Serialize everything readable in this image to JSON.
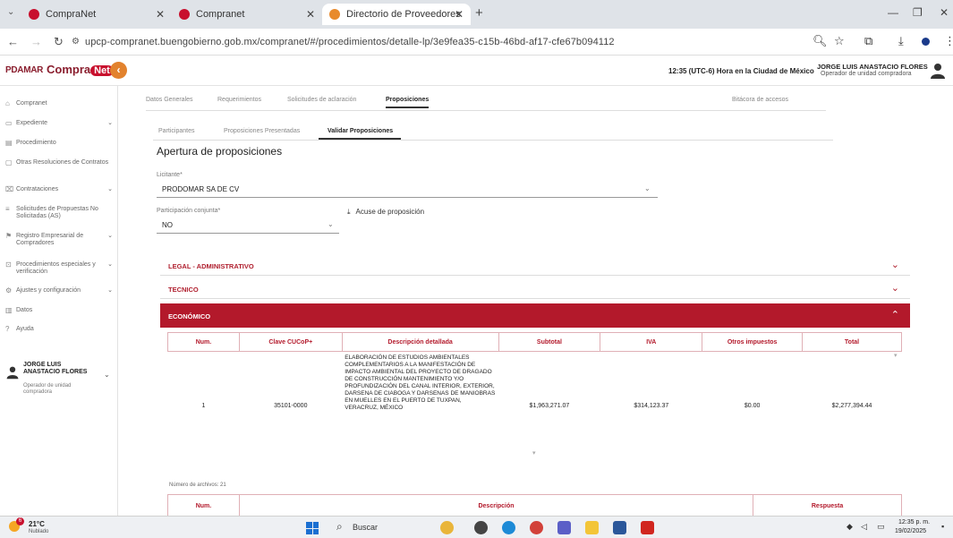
{
  "browser": {
    "tabs": [
      {
        "label": "CompraNet"
      },
      {
        "label": "Compranet"
      },
      {
        "label": "Directorio de Proveedores y C"
      }
    ],
    "url": "upcp-compranet.buengobierno.gob.mx/compranet/#/procedimientos/detalle-lp/3e9fea35-c15b-46bd-af17-cfe67b094112"
  },
  "header": {
    "logo_left": "PDAMAR",
    "logo_compra": "Compra",
    "logo_net": "Net",
    "time_text": "12:35 (UTC-6) Hora en la Ciudad de México",
    "user_name": "JORGE LUIS ANASTACIO FLORES",
    "user_role": "Operador de unidad compradora"
  },
  "sidebar": {
    "items": [
      {
        "label": "Compranet",
        "icon": "home-icon"
      },
      {
        "label": "Expediente",
        "icon": "folder-icon",
        "chevron": "⌄"
      },
      {
        "label": "Procedimiento",
        "icon": "document-icon"
      },
      {
        "label": "Otras Resoluciones de Contratos",
        "icon": "document-icon"
      },
      {
        "label": "Contrataciones",
        "icon": "contract-icon",
        "chevron": "⌄"
      },
      {
        "label": "Solicitudes de Propuestas No Solicitadas (AS)",
        "icon": "list-icon"
      },
      {
        "label": "Registro Empresarial de Compradores",
        "icon": "registry-icon",
        "chevron": "⌄"
      },
      {
        "label": "Procedimientos especiales y verificación",
        "icon": "verify-icon",
        "chevron": "⌄"
      },
      {
        "label": "Ajustes y configuración",
        "icon": "gear-icon",
        "chevron": "⌄"
      },
      {
        "label": "Datos",
        "icon": "data-icon"
      },
      {
        "label": "Ayuda",
        "icon": "help-icon"
      }
    ],
    "user": {
      "name_line1": "JORGE LUIS",
      "name_line2": "ANASTACIO FLORES",
      "role": "Operador de unidad compradora"
    }
  },
  "tabs_primary": [
    {
      "label": "Datos Generales"
    },
    {
      "label": "Requerimientos"
    },
    {
      "label": "Solicitudes de aclaración"
    },
    {
      "label": "Proposiciones"
    },
    {
      "label": "Bitácora de accesos"
    }
  ],
  "tabs_secondary": [
    {
      "label": "Participantes"
    },
    {
      "label": "Proposiciones Presentadas"
    },
    {
      "label": "Validar Proposiciones"
    }
  ],
  "section": {
    "title": "Apertura de proposiciones",
    "licitante_label": "Licitante*",
    "licitante_value": "PRODOMAR SA DE CV",
    "participacion_label": "Participación conjunta*",
    "participacion_value": "NO",
    "acuse_label": "Acuse de proposición"
  },
  "accordions": {
    "legal": "LEGAL - ADMINISTRATIVO",
    "tecnico": "TECNICO",
    "economico": "ECONÓMICO"
  },
  "econ_table": {
    "headers": [
      "Num.",
      "Clave CUCoP+",
      "Descripción detallada",
      "Subtotal",
      "IVA",
      "Otros impuestos",
      "Total"
    ],
    "row": {
      "num": "1",
      "clave": "35101-0000",
      "descripcion": "ELABORACIÓN DE ESTUDIOS AMBIENTALES COMPLEMENTARIOS A LA MANIFESTACIÓN DE IMPACTO AMBIENTAL DEL PROYECTO DE DRAGADO DE CONSTRUCCIÓN MANTENIMIENTO Y/O PROFUNDIZACIÓN DEL CANAL INTERIOR, EXTERIOR, DARSENA DE CIABOGA Y DARSENAS DE MANIOBRAS EN MUELLES EN EL PUERTO DE TUXPAN, VERACRUZ, MÉXICO",
      "subtotal": "$1,963,271.07",
      "iva": "$314,123.37",
      "otros": "$0.00",
      "total": "$2,277,394.44"
    }
  },
  "files_table": {
    "num_files_label": "Número de archivos: 21",
    "headers": [
      "Num.",
      "Descripción",
      "Respuesta"
    ]
  },
  "taskbar": {
    "weather_badge": "6",
    "weather_temp": "21°C",
    "weather_desc": "Nublado",
    "search_label": "Buscar",
    "clock_time": "12:35 p. m.",
    "clock_date": "19/02/2025"
  }
}
